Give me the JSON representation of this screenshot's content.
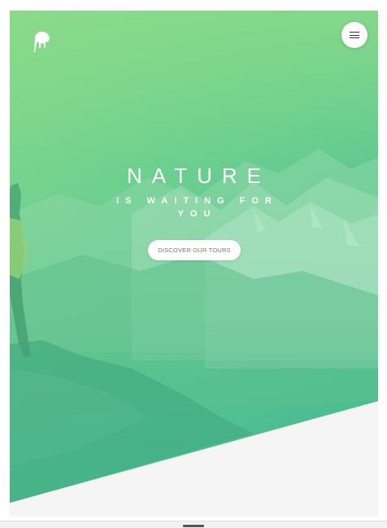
{
  "hero": {
    "title": "NATURE",
    "subtitle": "IS WAITING FOR YOU",
    "cta_label": "DISCOVER OUR TOURS"
  },
  "header": {
    "logo_icon": "elephant-icon",
    "menu_icon": "hamburger-menu-icon"
  },
  "colors": {
    "gradient_start": "#8fdc8c",
    "gradient_end": "#43b792",
    "page_background": "#f5f5f5",
    "button_background": "#ffffff"
  }
}
